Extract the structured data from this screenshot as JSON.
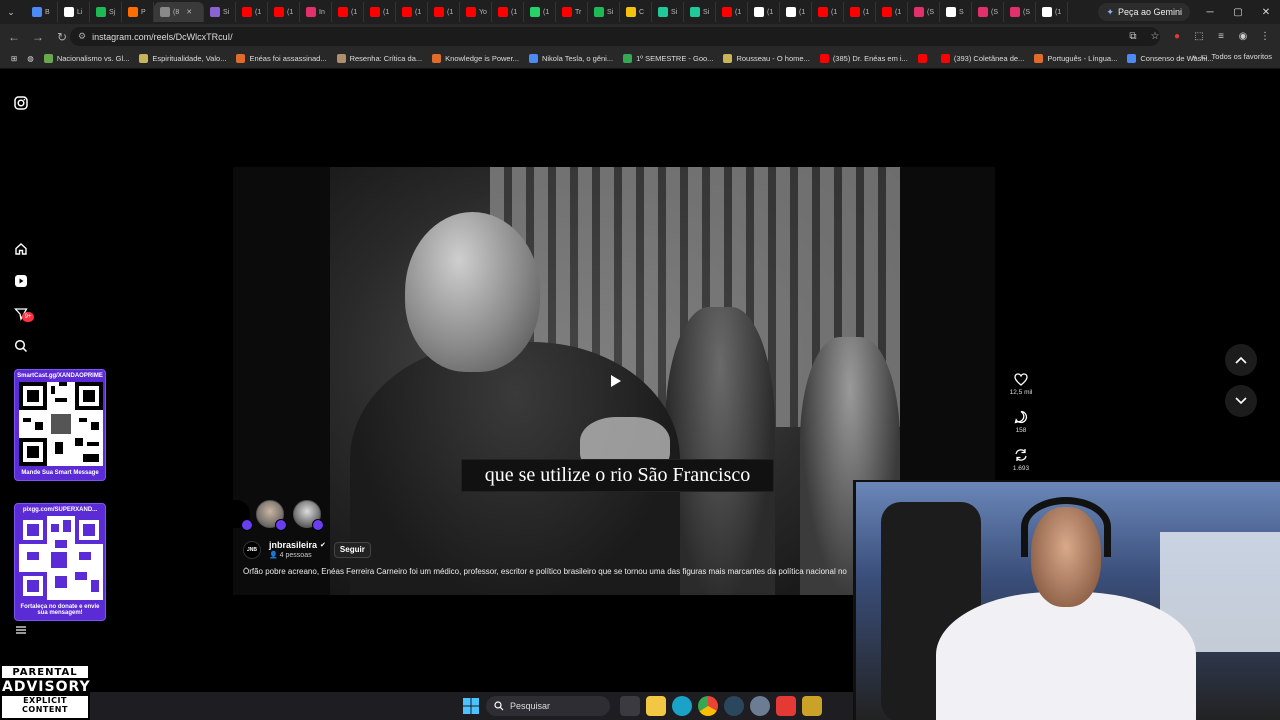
{
  "browser": {
    "tabs": [
      {
        "label": "B",
        "color": "#4c8bf5"
      },
      {
        "label": "Li",
        "color": "#ffffff"
      },
      {
        "label": "Sj",
        "color": "#1db954"
      },
      {
        "label": "P",
        "color": "#ff6d00"
      },
      {
        "label": "(8",
        "color": "#888888",
        "active": true
      },
      {
        "label": "Si",
        "color": "#8a63d2"
      },
      {
        "label": "(1",
        "color": "#ff0000"
      },
      {
        "label": "(1",
        "color": "#ff0000"
      },
      {
        "label": "In",
        "color": "#e1306c"
      },
      {
        "label": "(1",
        "color": "#ff0000"
      },
      {
        "label": "(1",
        "color": "#ff0000"
      },
      {
        "label": "(1",
        "color": "#ff0000"
      },
      {
        "label": "(1",
        "color": "#ff0000"
      },
      {
        "label": "Yo",
        "color": "#ff0000"
      },
      {
        "label": "(1",
        "color": "#ff0000"
      },
      {
        "label": "(1",
        "color": "#25d366"
      },
      {
        "label": "Tr",
        "color": "#ff0000"
      },
      {
        "label": "Si",
        "color": "#1db954"
      },
      {
        "label": "C",
        "color": "#f4c20d"
      },
      {
        "label": "Si",
        "color": "#20c997"
      },
      {
        "label": "Si",
        "color": "#20c997"
      },
      {
        "label": "(1",
        "color": "#ff0000"
      },
      {
        "label": "(1",
        "color": "#ffffff"
      },
      {
        "label": "(1",
        "color": "#ffffff"
      },
      {
        "label": "(1",
        "color": "#ff0000"
      },
      {
        "label": "(1",
        "color": "#ff0000"
      },
      {
        "label": "(1",
        "color": "#ff0000"
      },
      {
        "label": "(S",
        "color": "#e1306c"
      },
      {
        "label": "S",
        "color": "#ffffff"
      },
      {
        "label": "(S",
        "color": "#e1306c"
      },
      {
        "label": "(S",
        "color": "#e1306c"
      },
      {
        "label": "(1",
        "color": "#ffffff"
      }
    ],
    "gemini_label": "Peça ao Gemini",
    "url": "instagram.com/reels/DcWlcxTRcuI/",
    "bookmarks": [
      {
        "label": "Nacionalismo vs. Gl...",
        "color": "#6aa84f"
      },
      {
        "label": "Espiritualidade, Valo...",
        "color": "#c9b458"
      },
      {
        "label": "Enéas foi assassinad...",
        "color": "#e06c2b"
      },
      {
        "label": "Resenha: Crítica da...",
        "color": "#b0906c"
      },
      {
        "label": "Knowledge is Power...",
        "color": "#e06c2b"
      },
      {
        "label": "Nikola Tesla, o gêni...",
        "color": "#4c8bf5"
      },
      {
        "label": "1º SEMESTRE - Goo...",
        "color": "#34a853"
      },
      {
        "label": "Rousseau - O home...",
        "color": "#c9b458"
      },
      {
        "label": "(385) Dr. Enéas em i...",
        "color": "#ff0000"
      },
      {
        "label": "",
        "color": "#ff0000"
      },
      {
        "label": "(393) Coletânea de...",
        "color": "#ff0000"
      },
      {
        "label": "Português - Língua...",
        "color": "#e06c2b"
      },
      {
        "label": "Consenso de Washi...",
        "color": "#4c8bf5"
      }
    ],
    "all_bookmarks_label": "Todos os favoritos"
  },
  "sidebar": {
    "badge": "9+",
    "qr1": {
      "top": "SmartCast.gg/XANDAOPRIME",
      "bottom": "Mande Sua Smart Message"
    },
    "qr2": {
      "top": "pixgg.com/SUPERXAND...",
      "bottom": "Fortaleça no donate e envie sua mensagem!"
    }
  },
  "reel": {
    "subtitle": "que se utilize o rio São Francisco",
    "author_logo": "JNB",
    "author": "jnbrasileira",
    "people_count": "4 pessoas",
    "follow_label": "Seguir",
    "caption": "Órfão pobre acreano, Enéas Ferreira Carneiro foi um médico, professor, escritor e político brasileiro que se tornou uma das figuras mais marcantes da política nacional no",
    "likes": "12,5 mil",
    "comments": "158",
    "reposts": "1.693"
  },
  "taskbar": {
    "search_placeholder": "Pesquisar"
  },
  "advisory": {
    "line1": "PARENTAL",
    "line2": "ADVISORY",
    "line3": "EXPLICIT CONTENT"
  }
}
